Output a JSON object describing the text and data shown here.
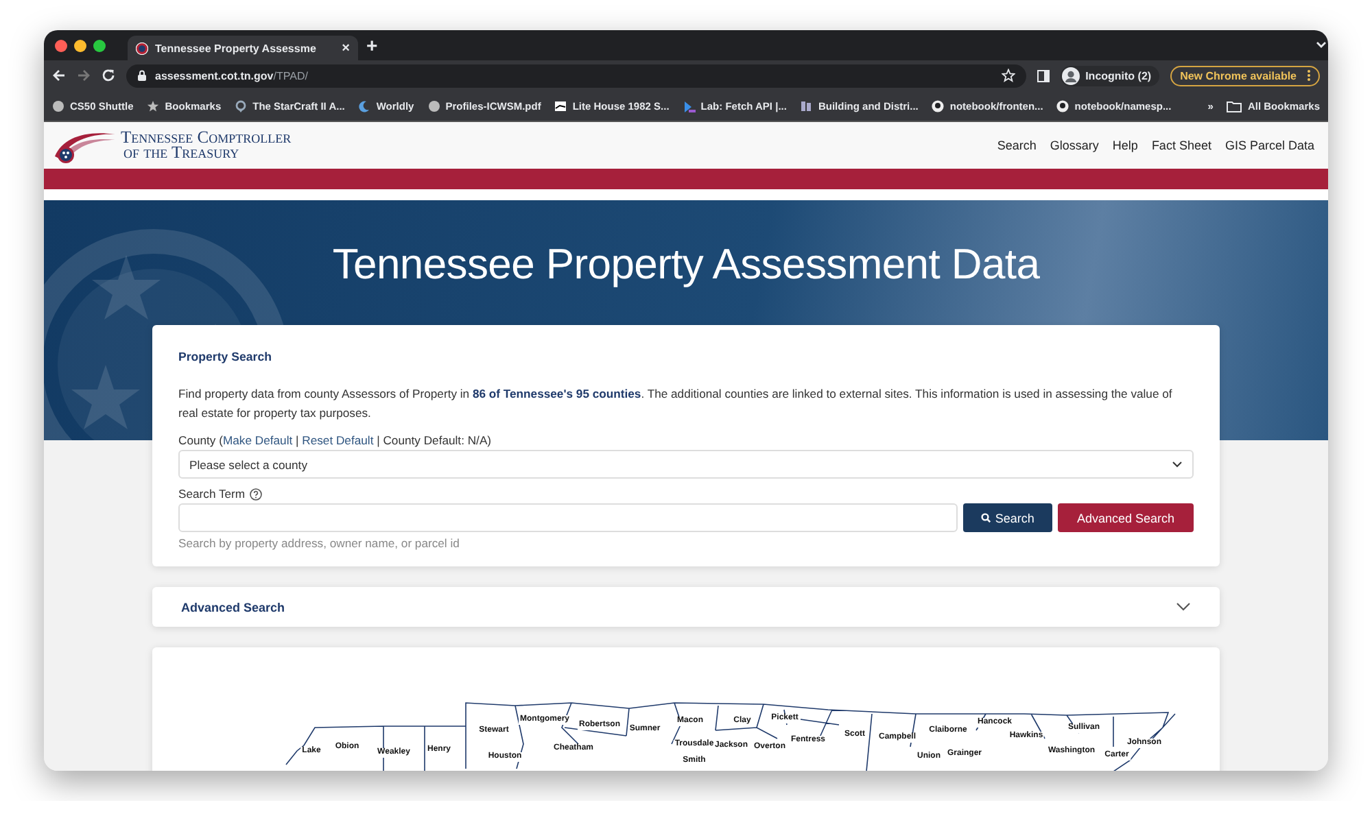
{
  "browser": {
    "tab": {
      "title": "Tennessee Property Assessme",
      "close": "×"
    },
    "new_tab": "+",
    "url": {
      "host": "assessment.cot.tn.gov",
      "path": "/TPAD/"
    },
    "profile": "Incognito (2)",
    "update_button": "New Chrome available",
    "bookmarks": [
      {
        "label": "CS50 Shuttle"
      },
      {
        "label": "Bookmarks"
      },
      {
        "label": "The StarCraft II A..."
      },
      {
        "label": "Worldly"
      },
      {
        "label": "Profiles-ICWSM.pdf"
      },
      {
        "label": "Lite House 1982 S..."
      },
      {
        "label": "Lab: Fetch API |..."
      },
      {
        "label": "Building and Distri..."
      },
      {
        "label": "notebook/fronten..."
      },
      {
        "label": "notebook/namesp..."
      }
    ],
    "overflow": "»",
    "all_bookmarks": "All Bookmarks"
  },
  "site": {
    "logo": {
      "line1": "Tennessee Comptroller",
      "line2": "of the Treasury"
    },
    "nav": [
      "Search",
      "Glossary",
      "Help",
      "Fact Sheet",
      "GIS Parcel Data"
    ]
  },
  "hero": {
    "title": "Tennessee Property Assessment Data"
  },
  "search_card": {
    "heading": "Property Search",
    "description": "Find property data from county Assessors of Property in **86 of Tennessee's 95 counties**. The additional counties are linked to external sites. This information is used in assessing the value of real estate for property tax purposes.",
    "county_label": [
      {
        "kind": "text",
        "text": "County ("
      },
      {
        "kind": "link",
        "text": "Make Default"
      },
      {
        "kind": "text",
        "text": " | "
      },
      {
        "kind": "link",
        "text": "Reset Default"
      },
      {
        "kind": "text",
        "text": " | County Default: N/A)"
      }
    ],
    "county_select": "Please select a county",
    "search_term_label": "Search Term",
    "help_text": "Search by property address, owner name, or parcel id",
    "search_button": "Search",
    "advanced_button": "Advanced Search"
  },
  "advanced_section": {
    "title": "Advanced Search",
    "expanded": false
  },
  "map": {
    "counties": [
      "Lake",
      "Obion",
      "Weakley",
      "Henry",
      "Stewart",
      "Montgomery",
      "Robertson",
      "Sumner",
      "Macon",
      "Clay",
      "Pickett",
      "Fentress",
      "Scott",
      "Campbell",
      "Claiborne",
      "Hancock",
      "Hawkins",
      "Sullivan",
      "Johnson",
      "Houston",
      "Cheatham",
      "Trousdale",
      "Smith",
      "Jackson",
      "Overton",
      "Union",
      "Grainger",
      "Washington",
      "Carter"
    ]
  }
}
